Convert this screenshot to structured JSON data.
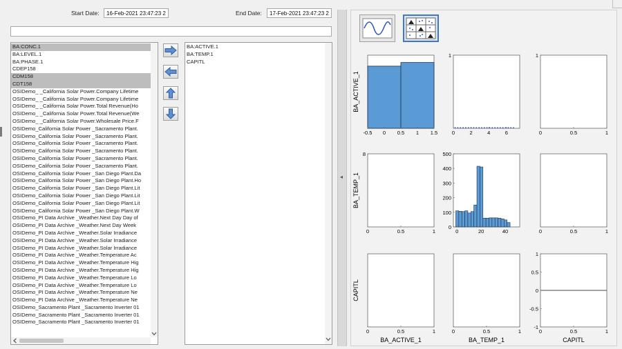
{
  "dates": {
    "start_label": "Start Date:",
    "start_value": "16-Feb-2021 23:47:23 2",
    "end_label": "End Date:",
    "end_value": "17-Feb-2021 23:47:23 2"
  },
  "search": {
    "value": ""
  },
  "tag_list": {
    "items": [
      {
        "label": "BA:CONC.1",
        "selected": true
      },
      {
        "label": "BA:LEVEL.1",
        "selected": false
      },
      {
        "label": "BA:PHASE.1",
        "selected": false
      },
      {
        "label": "CDEP158",
        "selected": false
      },
      {
        "label": "CDM158",
        "selected": true
      },
      {
        "label": "CDT158",
        "selected": true
      },
      {
        "label": "OSIDemo_ _California Solar Power.Company Lifetime",
        "selected": false
      },
      {
        "label": "OSIDemo_ _California Solar Power.Company Lifetime",
        "selected": false
      },
      {
        "label": "OSIDemo_ _California Solar Power.Total Revenue(Ho",
        "selected": false
      },
      {
        "label": "OSIDemo_ _California Solar Power.Total Revenue(We",
        "selected": false
      },
      {
        "label": "OSIDemo_ _California Solar Power.Wholesale Price.F",
        "selected": false
      },
      {
        "label": "OSIDemo_California Solar Power _Sacramento Plant.",
        "selected": false
      },
      {
        "label": "OSIDemo_California Solar Power _Sacramento Plant.",
        "selected": false
      },
      {
        "label": "OSIDemo_California Solar Power _Sacramento Plant.",
        "selected": false
      },
      {
        "label": "OSIDemo_California Solar Power _Sacramento Plant.",
        "selected": false
      },
      {
        "label": "OSIDemo_California Solar Power _Sacramento Plant.",
        "selected": false
      },
      {
        "label": "OSIDemo_California Solar Power _Sacramento Plant.",
        "selected": false
      },
      {
        "label": "OSIDemo_California Solar Power _San Diego Plant.Da",
        "selected": false
      },
      {
        "label": "OSIDemo_California Solar Power _San Diego Plant.Ho",
        "selected": false
      },
      {
        "label": "OSIDemo_California Solar Power _San Diego Plant.Lit",
        "selected": false
      },
      {
        "label": "OSIDemo_California Solar Power _San Diego Plant.Lit",
        "selected": false
      },
      {
        "label": "OSIDemo_California Solar Power _San Diego Plant.Lit",
        "selected": false
      },
      {
        "label": "OSIDemo_California Solar Power _San Diego Plant.W",
        "selected": false
      },
      {
        "label": "OSIDemo_PI Data Archive _Weather.Next Day Day of",
        "selected": false
      },
      {
        "label": "OSIDemo_PI Data Archive _Weather.Next Day Week",
        "selected": false
      },
      {
        "label": "OSIDemo_PI Data Archive _Weather.Solar Irradiance",
        "selected": false
      },
      {
        "label": "OSIDemo_PI Data Archive _Weather.Solar Irradiance",
        "selected": false
      },
      {
        "label": "OSIDemo_PI Data Archive _Weather.Solar Irradiance",
        "selected": false
      },
      {
        "label": "OSIDemo_PI Data Archive _Weather.Temperature Ac",
        "selected": false
      },
      {
        "label": "OSIDemo_PI Data Archive _Weather.Temperature Hig",
        "selected": false
      },
      {
        "label": "OSIDemo_PI Data Archive _Weather.Temperature Hig",
        "selected": false
      },
      {
        "label": "OSIDemo_PI Data Archive _Weather.Temperature Lo",
        "selected": false
      },
      {
        "label": "OSIDemo_PI Data Archive _Weather.Temperature Lo",
        "selected": false
      },
      {
        "label": "OSIDemo_PI Data Archive _Weather.Temperature Ne",
        "selected": false
      },
      {
        "label": "OSIDemo_PI Data Archive _Weather.Temperature Ne",
        "selected": false
      },
      {
        "label": "OSIDemo_Sacramento Plant _Sacramento Inverter 01",
        "selected": false
      },
      {
        "label": "OSIDemo_Sacramento Plant _Sacramento Inverter 01",
        "selected": false
      },
      {
        "label": "OSIDemo_Sacramento Plant _Sacramento Inverter 01",
        "selected": false
      }
    ]
  },
  "selected_list": {
    "items": [
      "BA:ACTIVE.1",
      "BA:TEMP.1",
      "CAPITL"
    ]
  },
  "splitter": {
    "glyph": "◂"
  },
  "plot_type_buttons": [
    {
      "icon": "sine-wave-icon",
      "active": false
    },
    {
      "icon": "scatter-matrix-icon",
      "active": true
    }
  ],
  "colors": {
    "bar_fill": "#5b9bd5",
    "bar_stroke": "#1f2f4a",
    "selection": "#bdbdbd"
  },
  "chart_data": [
    {
      "type": "bar",
      "cell": "row1-col1",
      "ylabel": "BA_ACTIVE_1",
      "bins": [
        [
          -0.5,
          0.5
        ],
        [
          0.5,
          1.5
        ]
      ],
      "values": [
        17,
        18
      ],
      "xlim": [
        -0.5,
        1.5
      ],
      "ylim": [
        0,
        20
      ],
      "xticks": [
        "-0.5",
        "0",
        "0.5",
        "1",
        "1.5"
      ],
      "yticks": []
    },
    {
      "type": "scatter",
      "cell": "row1-col2",
      "xlim": [
        0,
        7.5
      ],
      "ylim": [
        0,
        1
      ],
      "xticks": [
        "0",
        "2",
        "4",
        "6"
      ],
      "yticks": [
        "1"
      ],
      "points": [
        [
          0.2,
          0
        ],
        [
          0.5,
          0
        ],
        [
          0.8,
          0
        ],
        [
          1.1,
          0
        ],
        [
          1.4,
          0
        ],
        [
          1.7,
          0
        ],
        [
          2,
          0
        ],
        [
          2.3,
          0
        ],
        [
          2.6,
          0
        ],
        [
          2.9,
          0
        ],
        [
          3.2,
          0
        ],
        [
          3.5,
          0
        ],
        [
          3.8,
          0
        ],
        [
          4.1,
          0
        ],
        [
          4.4,
          0
        ],
        [
          4.7,
          0
        ],
        [
          5,
          0
        ],
        [
          5.3,
          0
        ],
        [
          5.6,
          0
        ],
        [
          5.9,
          0
        ],
        [
          6.2,
          0
        ],
        [
          6.5,
          0
        ],
        [
          6.8,
          0
        ]
      ]
    },
    {
      "type": "scatter",
      "cell": "row1-col3",
      "xlim": [
        0,
        1
      ],
      "ylim": [
        0,
        1
      ],
      "xticks": [
        "0",
        "0.5",
        "1"
      ],
      "yticks": [
        "1"
      ],
      "points": []
    },
    {
      "type": "scatter",
      "cell": "row2-col1",
      "ylabel": "BA_TEMP_1",
      "xlim": [
        0,
        1
      ],
      "ylim": [
        0,
        8
      ],
      "xticks": [
        "0",
        "0.5",
        "1"
      ],
      "yticks": [
        "8"
      ],
      "points": []
    },
    {
      "type": "bar",
      "cell": "row2-col2",
      "xlim": [
        -3,
        52
      ],
      "ylim": [
        0,
        500
      ],
      "xticks": [
        "0",
        "20",
        "40"
      ],
      "yticks": [
        "0",
        "100",
        "200",
        "300",
        "400",
        "500"
      ],
      "bin_start": -1,
      "bin_width": 2.5,
      "values": [
        110,
        107,
        105,
        110,
        95,
        105,
        150,
        415,
        410,
        60,
        60,
        62,
        62,
        62,
        60,
        55,
        48,
        30
      ]
    },
    {
      "type": "scatter",
      "cell": "row2-col3",
      "xlim": [
        0,
        1
      ],
      "ylim": [
        0,
        1
      ],
      "xticks": [
        "0",
        "0.5",
        "1"
      ],
      "yticks": [],
      "points": []
    },
    {
      "type": "scatter",
      "cell": "row3-col1",
      "ylabel": "CAPITL",
      "xlabel": "BA_ACTIVE_1",
      "xlim": [
        0,
        1
      ],
      "ylim": [
        0,
        1
      ],
      "xticks": [
        "0",
        "0.5",
        "1"
      ],
      "yticks": [],
      "points": []
    },
    {
      "type": "scatter",
      "cell": "row3-col2",
      "xlabel": "BA_TEMP_1",
      "xlim": [
        0,
        1
      ],
      "ylim": [
        0,
        1
      ],
      "xticks": [
        "0",
        "0.5",
        "1"
      ],
      "yticks": [],
      "points": []
    },
    {
      "type": "line",
      "cell": "row3-col3",
      "xlabel": "CAPITL",
      "xlim": [
        0,
        1
      ],
      "ylim": [
        -1,
        1
      ],
      "xticks": [
        "0",
        "0.5",
        "1"
      ],
      "yticks": [
        "-1",
        "-0.5",
        "0",
        "0.5",
        "1"
      ],
      "x": [
        0,
        1
      ],
      "y": [
        0,
        0
      ]
    }
  ]
}
